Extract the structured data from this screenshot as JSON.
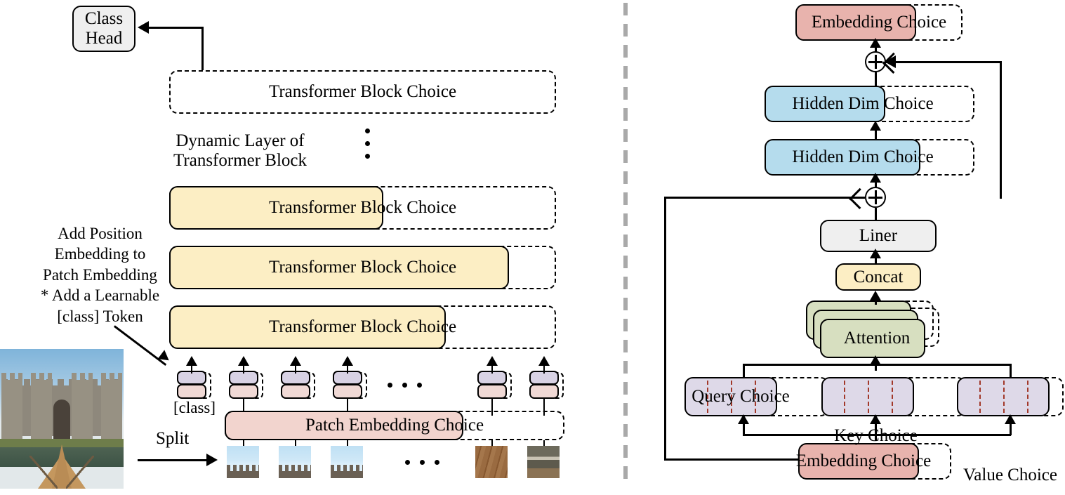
{
  "left_panel": {
    "class_head": {
      "line1": "Class",
      "line2": "Head"
    },
    "top_block_label": "Transformer Block Choice",
    "dynamic_layer_label": {
      "line1": "Dynamic Layer of",
      "line2": "Transformer Block"
    },
    "transformer_blocks": [
      {
        "label": "Transformer Block Choice",
        "fill_ratio": 0.52
      },
      {
        "label": "Transformer Block Choice",
        "fill_ratio": 0.86
      },
      {
        "label": "Transformer Block Choice",
        "fill_ratio": 0.7
      }
    ],
    "position_note": {
      "line1": "Add Position",
      "line2": "Embedding to",
      "line3": "Patch Embedding",
      "line4": "* Add a Learnable",
      "line5": "[class] Token"
    },
    "class_token_label": "[class]",
    "patch_embedding_label": "Patch Embedding Choice",
    "split_label": "Split",
    "ellipsis": "..."
  },
  "right_panel": {
    "embedding_choice_top": "Embedding Choice",
    "hidden_dim_1": "Hidden Dim Choice",
    "hidden_dim_2": "Hidden Dim Choice",
    "liner": "Liner",
    "concat": "Concat",
    "attention": "Attention",
    "query_choice": "Query Choice",
    "key_choice": "Key Choice",
    "value_choice": "Value Choice",
    "embedding_choice_bottom": "Embedding Choice",
    "add_symbol": "+"
  },
  "colors": {
    "yellow_block": "#fceec4",
    "pink_block": "#e8b3ad",
    "pink_light": "#f0d9d5",
    "blue_block": "#b5dced",
    "green_block": "#d7dfc0",
    "purple_block": "#ded9e8",
    "gray_block": "#efefef",
    "red_dash": "#a2392a",
    "divider_gray": "#a9a9a9",
    "outline": "#000000"
  }
}
